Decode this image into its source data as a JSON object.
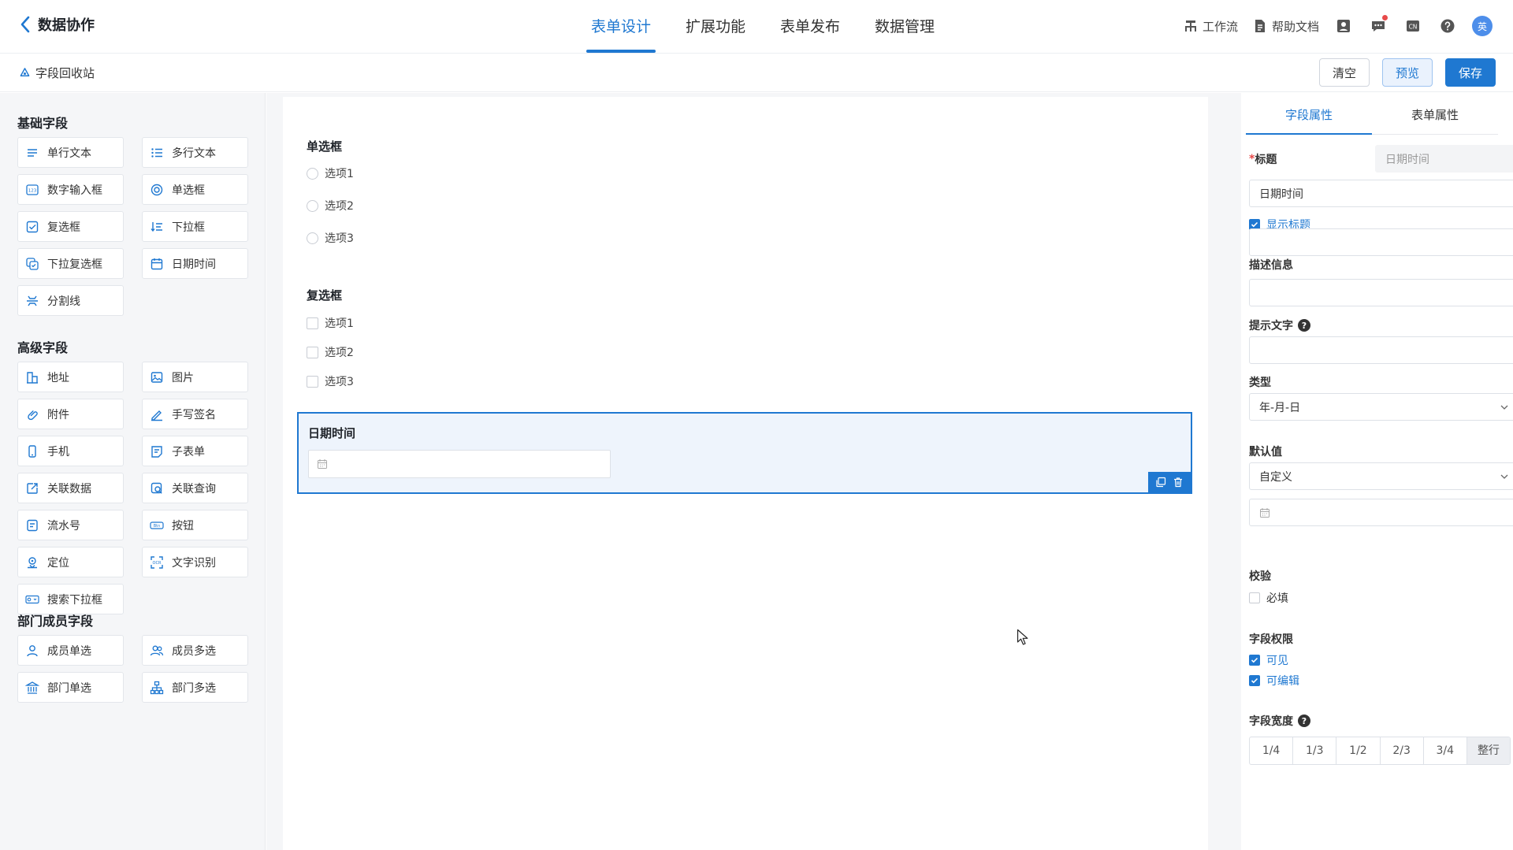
{
  "header": {
    "back_title": "数据协作",
    "tabs": [
      {
        "label": "表单设计",
        "active": true
      },
      {
        "label": "扩展功能",
        "active": false
      },
      {
        "label": "表单发布",
        "active": false
      },
      {
        "label": "数据管理",
        "active": false
      }
    ],
    "workflow_label": "工作流",
    "help_label": "帮助文档",
    "lang_badge": "CN",
    "avatar_text": "英"
  },
  "subbar": {
    "recycle_label": "字段回收站",
    "clear_label": "清空",
    "preview_label": "预览",
    "save_label": "保存"
  },
  "left_panel": {
    "groups": [
      {
        "title": "基础字段",
        "items": [
          {
            "label": "单行文本",
            "icon": "single-line-text-icon"
          },
          {
            "label": "多行文本",
            "icon": "multi-line-text-icon"
          },
          {
            "label": "数字输入框",
            "icon": "number-input-icon"
          },
          {
            "label": "单选框",
            "icon": "radio-icon"
          },
          {
            "label": "复选框",
            "icon": "checkbox-icon"
          },
          {
            "label": "下拉框",
            "icon": "dropdown-icon"
          },
          {
            "label": "下拉复选框",
            "icon": "multi-dropdown-icon"
          },
          {
            "label": "日期时间",
            "icon": "calendar-icon"
          },
          {
            "label": "分割线",
            "icon": "divider-icon"
          }
        ]
      },
      {
        "title": "高级字段",
        "items": [
          {
            "label": "地址",
            "icon": "address-icon"
          },
          {
            "label": "图片",
            "icon": "image-icon"
          },
          {
            "label": "附件",
            "icon": "attachment-icon"
          },
          {
            "label": "手写签名",
            "icon": "signature-icon"
          },
          {
            "label": "手机",
            "icon": "phone-icon"
          },
          {
            "label": "子表单",
            "icon": "subform-icon"
          },
          {
            "label": "关联数据",
            "icon": "linked-data-icon"
          },
          {
            "label": "关联查询",
            "icon": "linked-query-icon"
          },
          {
            "label": "流水号",
            "icon": "serial-number-icon"
          },
          {
            "label": "按钮",
            "icon": "button-icon"
          },
          {
            "label": "定位",
            "icon": "location-icon"
          },
          {
            "label": "文字识别",
            "icon": "ocr-icon"
          },
          {
            "label": "搜索下拉框",
            "icon": "search-dropdown-icon"
          }
        ]
      },
      {
        "title": "部门成员字段",
        "items": [
          {
            "label": "成员单选",
            "icon": "member-single-icon"
          },
          {
            "label": "成员多选",
            "icon": "member-multi-icon"
          },
          {
            "label": "部门单选",
            "icon": "department-single-icon"
          },
          {
            "label": "部门多选",
            "icon": "department-multi-icon"
          }
        ]
      }
    ]
  },
  "canvas": {
    "radio_field": {
      "label": "单选框",
      "options": [
        "选项1",
        "选项2",
        "选项3"
      ]
    },
    "checkbox_field": {
      "label": "复选框",
      "options": [
        "选项1",
        "选项2",
        "选项3"
      ]
    },
    "date_field": {
      "label": "日期时间"
    }
  },
  "right_panel": {
    "tabs": [
      {
        "label": "字段属性",
        "active": true
      },
      {
        "label": "表单属性",
        "active": false
      }
    ],
    "title_label": "标题",
    "title_required_mark": "*",
    "title_placeholder": "日期时间",
    "title_value": "日期时间",
    "show_title_label": "显示标题",
    "description_label": "描述信息",
    "hint_label": "提示文字",
    "type_label": "类型",
    "type_value": "年-月-日",
    "default_label": "默认值",
    "default_value": "自定义",
    "validation_label": "校验",
    "required_label": "必填",
    "permission_label": "字段权限",
    "visible_label": "可见",
    "editable_label": "可编辑",
    "width_label": "字段宽度",
    "width_options": [
      "1/4",
      "1/3",
      "1/2",
      "2/3",
      "3/4",
      "整行"
    ],
    "width_selected": "整行",
    "colors": {
      "accent": "#1f78d1",
      "bg_panel": "#f5f6f8",
      "selected_bg": "#eef4fc"
    }
  }
}
